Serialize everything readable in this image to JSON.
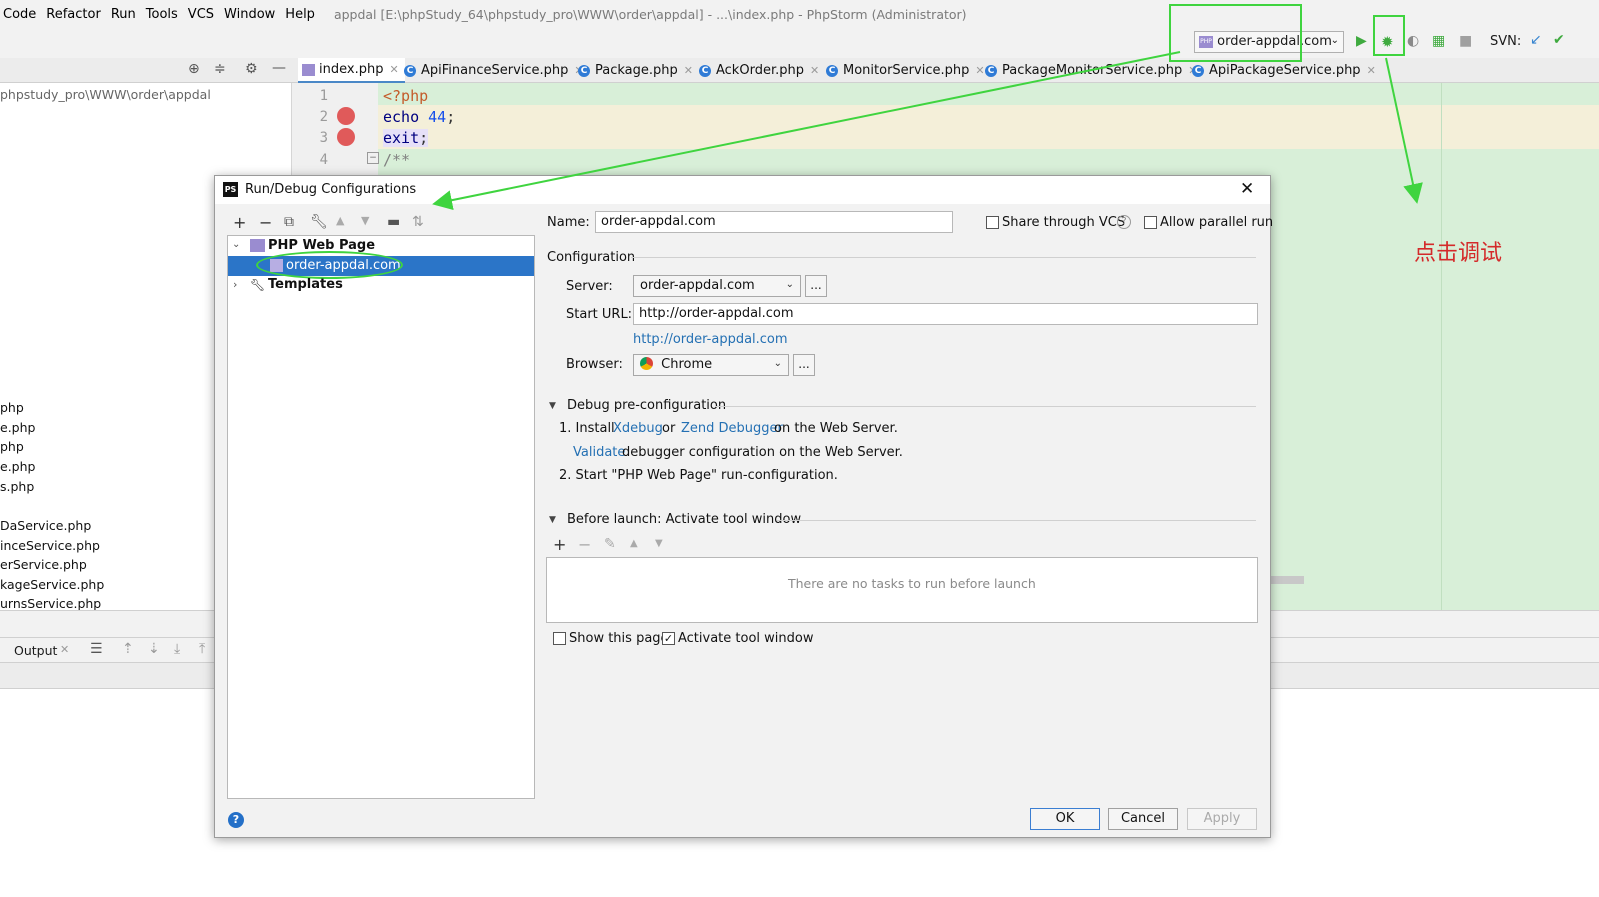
{
  "menubar": {
    "items": [
      "Code",
      "Refactor",
      "Run",
      "Tools",
      "VCS",
      "Window",
      "Help"
    ],
    "window_title": "appdal [E:\\phpStudy_64\\phpstudy_pro\\WWW\\order\\appdal] - ...\\index.php - PhpStorm (Administrator)"
  },
  "toolbar": {
    "run_config": "order-appdal.com",
    "svn_label": "SVN:"
  },
  "tabs": [
    "index.php",
    "ApiFinanceService.php",
    "Package.php",
    "AckOrder.php",
    "MonitorService.php",
    "PackageMonitorService.php",
    "ApiPackageService.php"
  ],
  "project": {
    "path": "phpstudy_pro\\WWW\\order\\appdal",
    "files": [
      "php",
      "e.php",
      "php",
      "e.php",
      "s.php",
      "DaService.php",
      "inceService.php",
      "erService.php",
      "kageService.php",
      "urnsService.php"
    ]
  },
  "editor": {
    "lines": [
      {
        "num": "1",
        "parts": [
          {
            "text": "<?php",
            "color": "#c45b2a"
          }
        ]
      },
      {
        "num": "2",
        "parts": [
          {
            "text": "echo",
            "color": "#000080"
          },
          {
            "text": " 44",
            "color": "#1750eb"
          },
          {
            "text": ";",
            "color": "#333333"
          }
        ]
      },
      {
        "num": "3",
        "parts": [
          {
            "text": "exit",
            "color": "#000080"
          },
          {
            "text": ";",
            "color": "#333333"
          }
        ]
      },
      {
        "num": "4",
        "parts": [
          {
            "text": "/**",
            "color": "#808080"
          }
        ]
      }
    ]
  },
  "bottom": {
    "output_tab": "Output"
  },
  "dialog": {
    "title": "Run/Debug Configurations",
    "tree": {
      "group": "PHP Web Page",
      "selected": "order-appdal.com",
      "templates": "Templates"
    },
    "name_label": "Name:",
    "name_value": "order-appdal.com",
    "share_vcs": "Share through VCS",
    "allow_parallel": "Allow parallel run",
    "configuration_label": "Configuration",
    "server_label": "Server:",
    "server_value": "order-appdal.com",
    "start_url_label": "Start URL:",
    "start_url_value": "http://order-appdal.com",
    "resolved_url": "http://order-appdal.com",
    "browser_label": "Browser:",
    "browser_value": "Chrome",
    "debug_section": "Debug pre-configuration",
    "step1_prefix": "1. Install",
    "step1_xdebug": "Xdebug",
    "step1_or": "or",
    "step1_zend": "Zend Debugger",
    "step1_suffix": "on the Web Server.",
    "step1b_validate": "Validate",
    "step1b_suffix": "debugger configuration on the Web Server.",
    "step2": "2. Start \"PHP Web Page\" run-configuration.",
    "before_launch": "Before launch: Activate tool window",
    "no_tasks": "There are no tasks to run before launch",
    "show_page": "Show this page",
    "activate_tool": "Activate tool window",
    "ok": "OK",
    "cancel": "Cancel",
    "apply": "Apply"
  },
  "annotation": {
    "text": "点击调试",
    "color": "#d42a2a",
    "arrow_color": "#3fd43f"
  }
}
